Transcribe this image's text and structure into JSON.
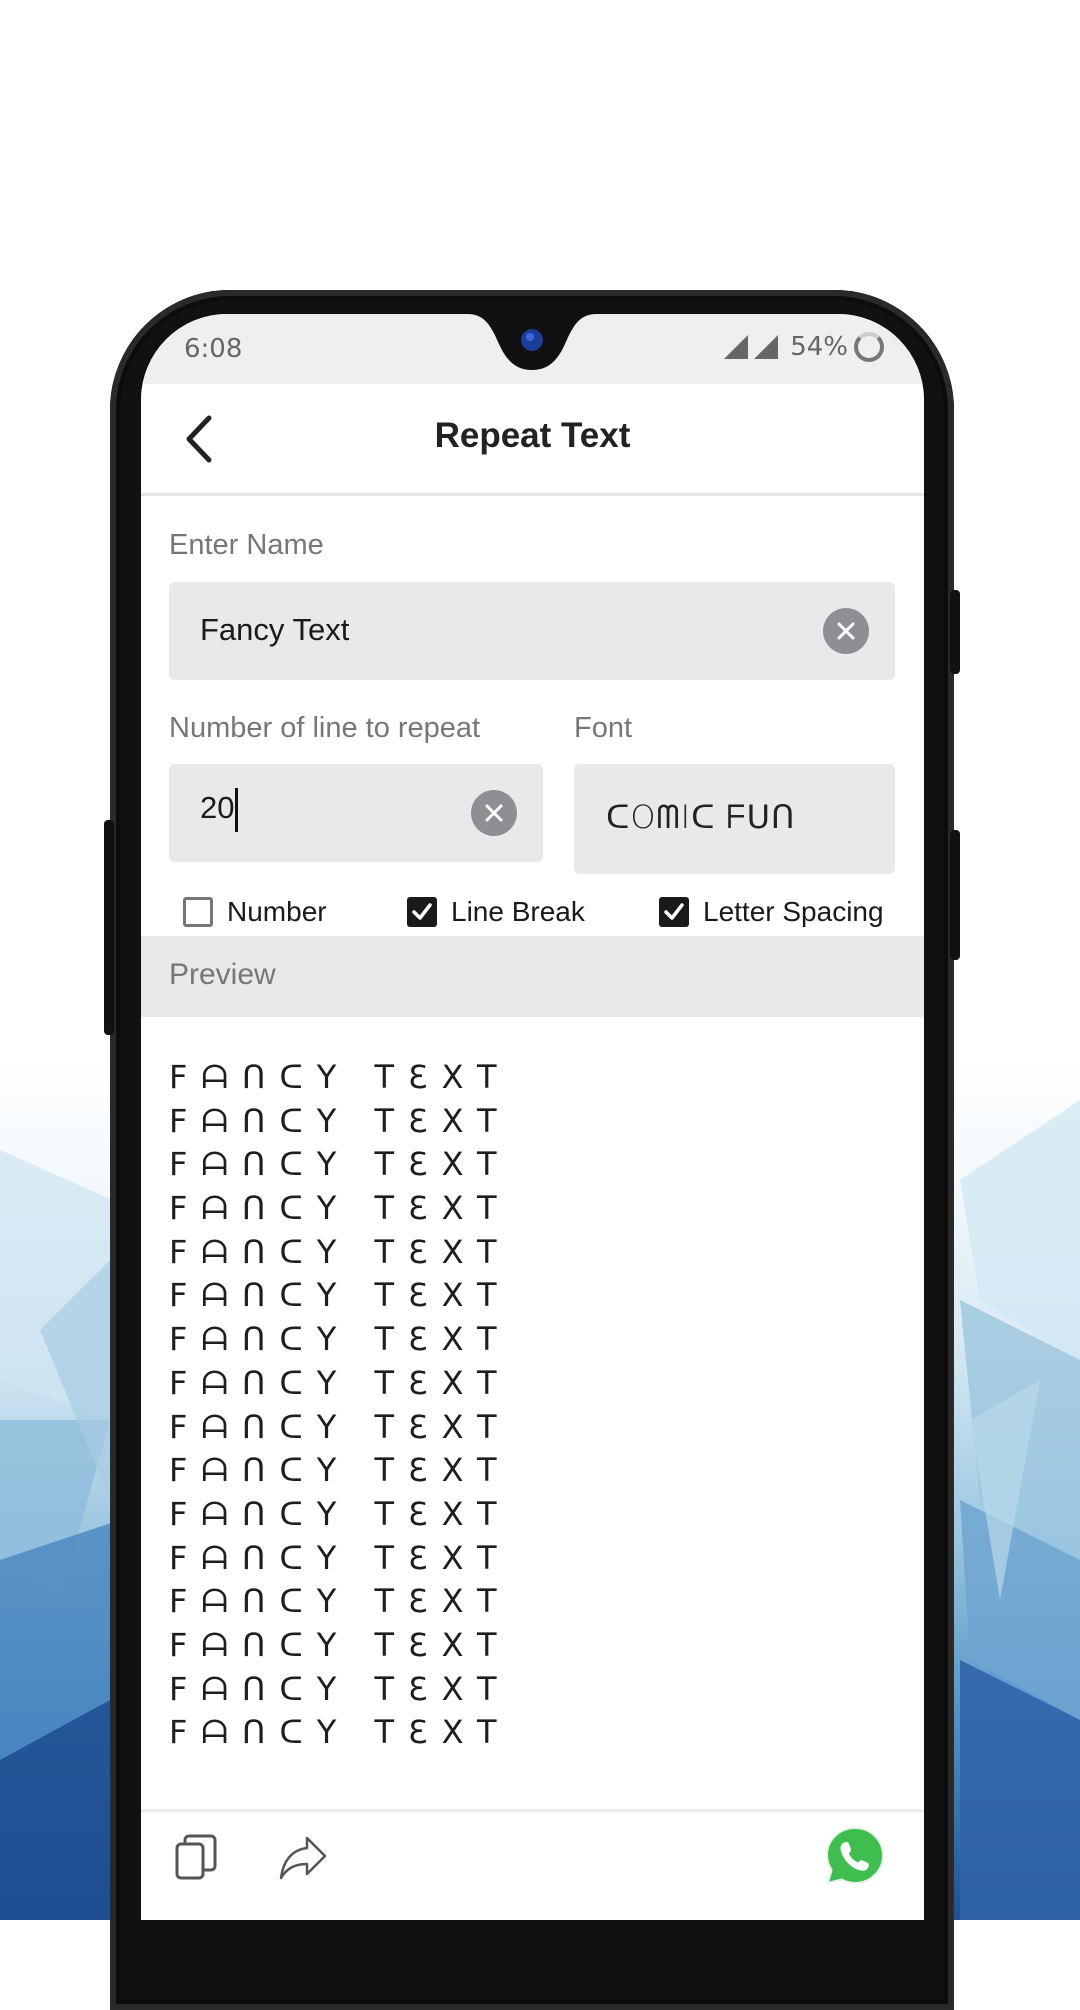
{
  "status_bar": {
    "time": "6:08",
    "battery": "54%",
    "icons": [
      "signal-icon",
      "signal-icon",
      "battery-icon"
    ]
  },
  "header": {
    "back_icon": "chevron-left-icon",
    "title": "Repeat Text"
  },
  "form": {
    "name": {
      "label": "Enter Name",
      "value": "Fancy Text",
      "clear_icon": "close-icon"
    },
    "repeat_count": {
      "label": "Number of line to repeat",
      "value": "20",
      "clear_icon": "close-icon"
    },
    "font": {
      "label": "Font",
      "value": "ᑕOᗰIᑕ ᖴᑌᑎ"
    }
  },
  "options": [
    {
      "label": "Number",
      "checked": false
    },
    {
      "label": "Line Break",
      "checked": true
    },
    {
      "label": "Letter Spacing",
      "checked": true
    }
  ],
  "preview": {
    "label": "Preview",
    "line_text": "FᗩᑎᑕY TƐXT",
    "visible_lines": 16
  },
  "bottom_bar": {
    "copy_icon": "copy-icon",
    "share_icon": "share-icon",
    "whatsapp_icon": "whatsapp-icon"
  },
  "colors": {
    "field_bg": "#e9e9ec",
    "whatsapp_green": "#3fbe4f",
    "checkbox_checked": "#1a1a1a"
  }
}
